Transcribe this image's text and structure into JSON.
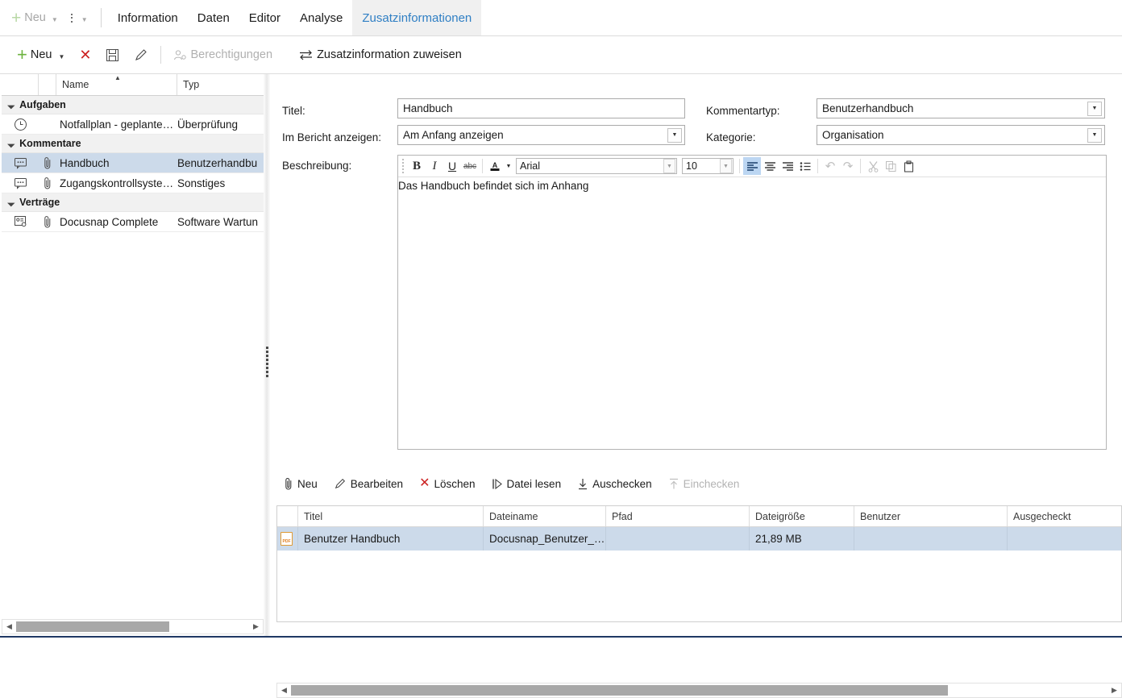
{
  "tabbar": {
    "new_label": "Neu",
    "new_icon": "plus-icon",
    "caret_icon": "chevron-down-icon",
    "overflow_icon": "vertical-dots-icon",
    "overflow_caret_icon": "chevron-down-icon",
    "tabs": [
      {
        "label": "Information",
        "active": false
      },
      {
        "label": "Daten",
        "active": false
      },
      {
        "label": "Editor",
        "active": false
      },
      {
        "label": "Analyse",
        "active": false
      },
      {
        "label": "Zusatzinformationen",
        "active": true
      }
    ],
    "active_tab_color": "#2f7fc4"
  },
  "cmdbar": {
    "items": [
      {
        "label": "Neu",
        "icon": "plus-icon",
        "disabled": false,
        "has_caret": true
      },
      {
        "label": "",
        "icon": "delete-x-icon",
        "disabled": false,
        "has_caret": false
      },
      {
        "label": "",
        "icon": "save-floppy-icon",
        "disabled": false,
        "has_caret": false
      },
      {
        "label": "",
        "icon": "edit-pencil-icon",
        "disabled": false,
        "has_caret": false
      },
      {
        "label": "Berechtigungen",
        "icon": "permissions-user-icon",
        "disabled": true,
        "has_caret": false
      },
      {
        "label": "Zusatzinformation zuweisen",
        "icon": "assign-arrows-icon",
        "disabled": false,
        "has_caret": false
      }
    ]
  },
  "tree": {
    "columns": [
      "",
      "",
      "Name",
      "Typ"
    ],
    "sort_indicator": "ascending-triangle-icon",
    "groups": [
      {
        "label": "Aufgaben",
        "rows": [
          {
            "icon": "clock-icon",
            "attachment": false,
            "name": "Notfallplan - geplante…",
            "typ": "Überprüfung",
            "selected": false
          }
        ]
      },
      {
        "label": "Kommentare",
        "rows": [
          {
            "icon": "comment-icon",
            "attachment": true,
            "name": "Handbuch",
            "typ": "Benutzerhandbu",
            "selected": true
          },
          {
            "icon": "comment-icon",
            "attachment": true,
            "name": "Zugangskontrollsyste…",
            "typ": "Sonstiges",
            "selected": false
          }
        ]
      },
      {
        "label": "Verträge",
        "rows": [
          {
            "icon": "contract-icon",
            "attachment": true,
            "name": "Docusnap Complete",
            "typ": "Software Wartun",
            "selected": false
          }
        ]
      }
    ],
    "hscroll": {
      "left_arrow": "triangle-left-icon",
      "right_arrow": "triangle-right-icon"
    }
  },
  "form": {
    "titel_label": "Titel:",
    "titel_value": "Handbuch",
    "bericht_label": "Im Bericht anzeigen:",
    "bericht_value": "Am Anfang anzeigen",
    "beschreibung_label": "Beschreibung:",
    "kommentartyp_label": "Kommentartyp:",
    "kommentartyp_value": "Benutzerhandbuch",
    "kategorie_label": "Kategorie:",
    "kategorie_value": "Organisation",
    "dropdown_icon": "chevron-down-icon"
  },
  "editor": {
    "font_name": "Arial",
    "font_size": "10",
    "body_text": "Das Handbuch befindet sich im Anhang",
    "buttons": [
      {
        "name": "bold-icon",
        "glyph": "B",
        "state": "normal"
      },
      {
        "name": "italic-icon",
        "glyph": "I",
        "state": "normal"
      },
      {
        "name": "underline-icon",
        "glyph": "U",
        "state": "normal"
      },
      {
        "name": "strikethrough-icon",
        "glyph": "abc",
        "state": "normal"
      },
      {
        "name": "font-color-icon",
        "glyph": "A",
        "state": "normal"
      },
      {
        "name": "align-left-icon",
        "glyph": "",
        "state": "active"
      },
      {
        "name": "align-center-icon",
        "glyph": "",
        "state": "normal"
      },
      {
        "name": "align-right-icon",
        "glyph": "",
        "state": "normal"
      },
      {
        "name": "bullet-list-icon",
        "glyph": "",
        "state": "normal"
      },
      {
        "name": "undo-icon",
        "glyph": "↶",
        "state": "disabled"
      },
      {
        "name": "redo-icon",
        "glyph": "↷",
        "state": "disabled"
      },
      {
        "name": "cut-icon",
        "glyph": "✂",
        "state": "disabled"
      },
      {
        "name": "copy-icon",
        "glyph": "",
        "state": "disabled"
      },
      {
        "name": "paste-icon",
        "glyph": "",
        "state": "normal"
      }
    ]
  },
  "attachment_toolbar": {
    "items": [
      {
        "label": "Neu",
        "icon": "paperclip-icon",
        "disabled": false
      },
      {
        "label": "Bearbeiten",
        "icon": "edit-pencil-icon",
        "disabled": false
      },
      {
        "label": "Löschen",
        "icon": "delete-x-icon",
        "disabled": false
      },
      {
        "label": "Datei lesen",
        "icon": "read-file-icon",
        "disabled": false
      },
      {
        "label": "Auschecken",
        "icon": "check-out-down-icon",
        "disabled": false
      },
      {
        "label": "Einchecken",
        "icon": "check-in-up-icon",
        "disabled": true
      }
    ]
  },
  "attachment_grid": {
    "columns": [
      "",
      "Titel",
      "Dateiname",
      "Pfad",
      "Dateigröße",
      "Benutzer",
      "Ausgecheckt"
    ],
    "rows": [
      {
        "icon": "pdf-file-icon",
        "titel": "Benutzer Handbuch",
        "dateiname": "Docusnap_Benutzer_…",
        "pfad": "",
        "dateigroesse": "21,89 MB",
        "benutzer": "",
        "ausgecheckt": "",
        "selected": true
      }
    ],
    "hscroll": {
      "left_arrow": "triangle-left-icon",
      "right_arrow": "triangle-right-icon"
    }
  },
  "colors": {
    "accent_blue": "#2f7fc4",
    "selection": "#ccdaea",
    "green": "#6cb33f",
    "red": "#cc2222",
    "pdf_orange": "#e07b1a",
    "status_bar": "#1f3864"
  }
}
